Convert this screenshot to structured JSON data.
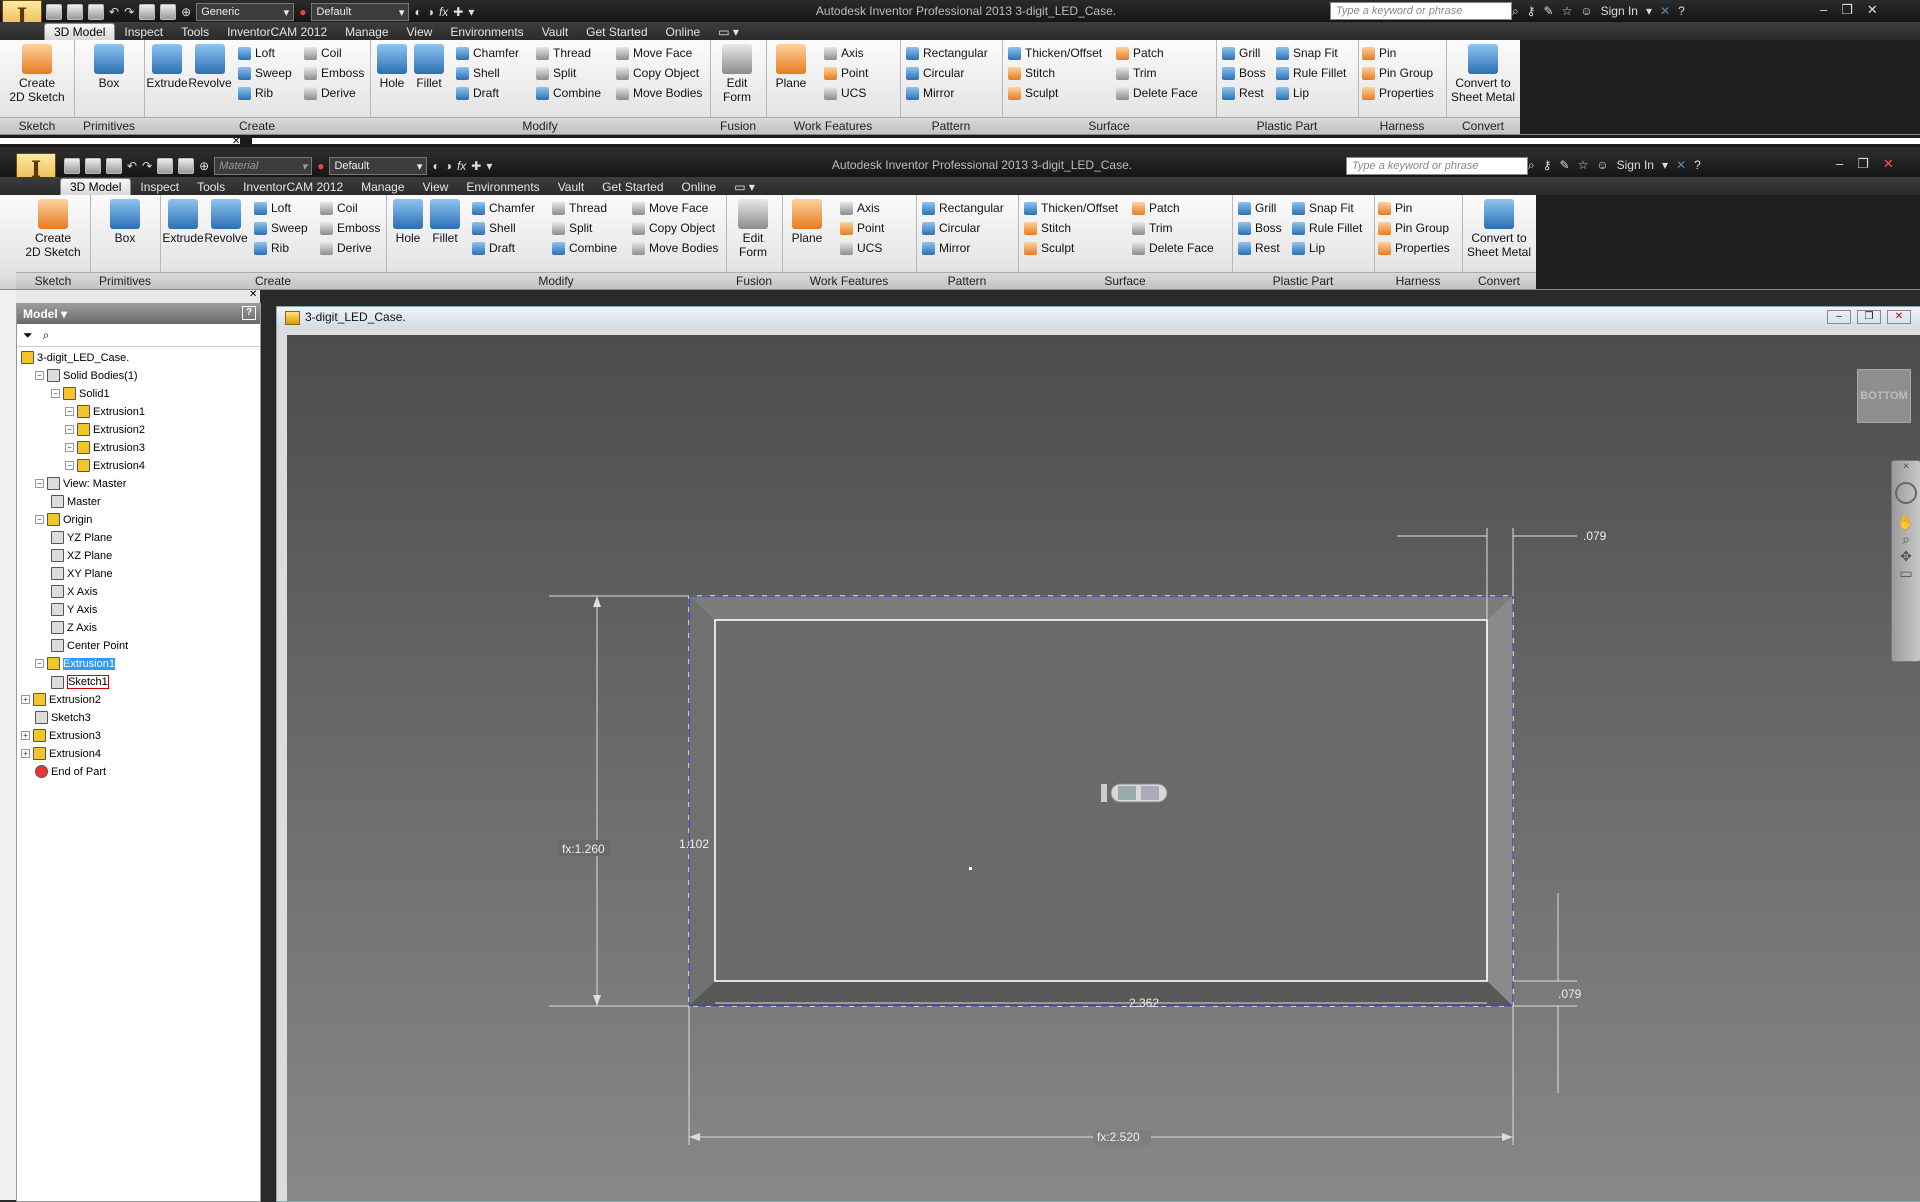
{
  "outer": {
    "window_title": "Autodesk Inventor Professional 2013    3-digit_LED_Case.",
    "material": "Generic",
    "appearance": "Default",
    "search_placeholder": "Type a keyword or phrase",
    "sign_in": "Sign In",
    "tabs": [
      "3D Model",
      "Inspect",
      "Tools",
      "InventorCAM 2012",
      "Manage",
      "View",
      "Environments",
      "Vault",
      "Get Started",
      "Online"
    ]
  },
  "inner": {
    "window_title": "Autodesk Inventor Professional 2013    3-digit_LED_Case.",
    "material": "Material",
    "appearance": "Default",
    "search_placeholder": "Type a keyword or phrase",
    "sign_in": "Sign In",
    "tabs": [
      "3D Model",
      "Inspect",
      "Tools",
      "InventorCAM 2012",
      "Manage",
      "View",
      "Environments",
      "Vault",
      "Get Started",
      "Online"
    ]
  },
  "ribbon": {
    "sketch": {
      "create_2d_sketch": "Create\n2D Sketch",
      "title": "Sketch"
    },
    "primitives": {
      "box": "Box",
      "title": "Primitives"
    },
    "create": {
      "extrude": "Extrude",
      "revolve": "Revolve",
      "loft": "Loft",
      "sweep": "Sweep",
      "rib": "Rib",
      "coil": "Coil",
      "emboss": "Emboss",
      "derive": "Derive",
      "title": "Create"
    },
    "modify": {
      "hole": "Hole",
      "fillet": "Fillet",
      "chamfer": "Chamfer",
      "shell": "Shell",
      "draft": "Draft",
      "thread": "Thread",
      "split": "Split",
      "combine": "Combine",
      "move_face": "Move Face",
      "copy_object": "Copy Object",
      "move_bodies": "Move Bodies",
      "title": "Modify"
    },
    "fusion": {
      "edit_form": "Edit\nForm",
      "title": "Fusion"
    },
    "work_features": {
      "plane": "Plane",
      "axis": "Axis",
      "point": "Point",
      "ucs": "UCS",
      "title": "Work Features"
    },
    "pattern": {
      "rectangular": "Rectangular",
      "circular": "Circular",
      "mirror": "Mirror",
      "title": "Pattern"
    },
    "surface": {
      "thicken": "Thicken/Offset",
      "stitch": "Stitch",
      "sculpt": "Sculpt",
      "patch": "Patch",
      "trim": "Trim",
      "delete_face": "Delete Face",
      "title": "Surface"
    },
    "plastic": {
      "grill": "Grill",
      "boss": "Boss",
      "rest": "Rest",
      "snap_fit": "Snap Fit",
      "rule_fillet": "Rule Fillet",
      "lip": "Lip",
      "title": "Plastic Part"
    },
    "harness": {
      "pin": "Pin",
      "pin_group": "Pin Group",
      "properties": "Properties",
      "title": "Harness"
    },
    "convert": {
      "sheet_metal": "Convert to\nSheet Metal",
      "title": "Convert"
    }
  },
  "browser": {
    "title": "Model",
    "nodes": [
      {
        "label": "3-digit_LED_Case."
      },
      {
        "label": "Solid Bodies(1)"
      },
      {
        "label": "Solid1"
      },
      {
        "label": "Extrusion1"
      },
      {
        "label": "Extrusion2"
      },
      {
        "label": "Extrusion3"
      },
      {
        "label": "Extrusion4"
      },
      {
        "label": "View: Master"
      },
      {
        "label": "Master"
      },
      {
        "label": "Origin"
      },
      {
        "label": "YZ Plane"
      },
      {
        "label": "XZ Plane"
      },
      {
        "label": "XY Plane"
      },
      {
        "label": "X Axis"
      },
      {
        "label": "Y Axis"
      },
      {
        "label": "Z Axis"
      },
      {
        "label": "Center Point"
      },
      {
        "label": "Extrusion1"
      },
      {
        "label": "Sketch1"
      },
      {
        "label": "Extrusion2"
      },
      {
        "label": "Sketch3"
      },
      {
        "label": "Extrusion3"
      },
      {
        "label": "Extrusion4"
      },
      {
        "label": "End of Part"
      }
    ]
  },
  "document": {
    "title": "3-digit_LED_Case.",
    "viewcube": "BOTTOM",
    "dims": {
      "top_offset": ".079",
      "height_fx": "fx:1.260",
      "inner_height": "1.102",
      "inner_width": "2.362",
      "right_offset": ".079",
      "width_fx": "fx:2.520"
    }
  },
  "colors": {
    "ribbon_bg": "#e9e9e9",
    "titlebar": "#1e1e1e",
    "viewport_top": "#4c4c4c",
    "viewport_bottom": "#888888",
    "selection": "#3399ff"
  }
}
